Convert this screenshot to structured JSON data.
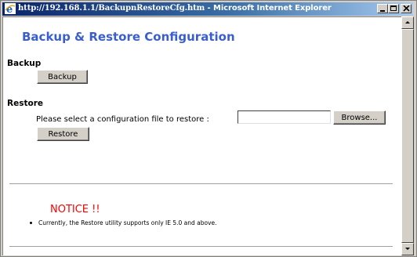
{
  "window": {
    "url": "http://192.168.1.1/BackupnRestoreCfg.htm",
    "separator": " - ",
    "app": "Microsoft Internet Explorer"
  },
  "page": {
    "title": "Backup & Restore Configuration"
  },
  "backup": {
    "label": "Backup",
    "button_label": "Backup"
  },
  "restore": {
    "label": "Restore",
    "prompt": "Please select a configuration file to restore :",
    "file_value": "",
    "browse_label": "Browse...",
    "button_label": "Restore"
  },
  "notice": {
    "title": "NOTICE !!",
    "items": [
      "Currently, the Restore utility supports only IE 5.0 and above."
    ]
  },
  "colors": {
    "title_blue": "#3a5fcd",
    "notice_red": "#ff0000",
    "titlebar_start": "#0a246a",
    "titlebar_end": "#a6caf0"
  }
}
